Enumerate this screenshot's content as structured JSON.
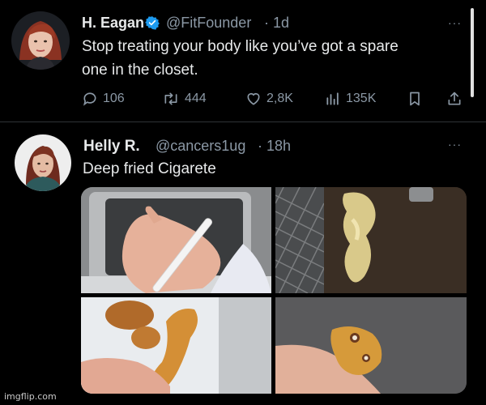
{
  "tweet1": {
    "name": "H. Eagan",
    "handle": "@FitFounder",
    "time": "· 1d",
    "text_line1": "Stop treating your body like you’ve got a spare",
    "text_line2": "one in the closet.",
    "replies": "106",
    "retweets": "444",
    "likes": "2,8K",
    "views": "135K",
    "more": "···"
  },
  "tweet2": {
    "name": "Helly R.",
    "handle": "@cancers1ug",
    "time": "· 18h",
    "text": "Deep fried Cigarete",
    "more": "···"
  },
  "watermark": "imgflip.com",
  "colors": {
    "verified": "#1d9bf0",
    "muted": "#8b98a5",
    "text": "#e7e9ea"
  }
}
